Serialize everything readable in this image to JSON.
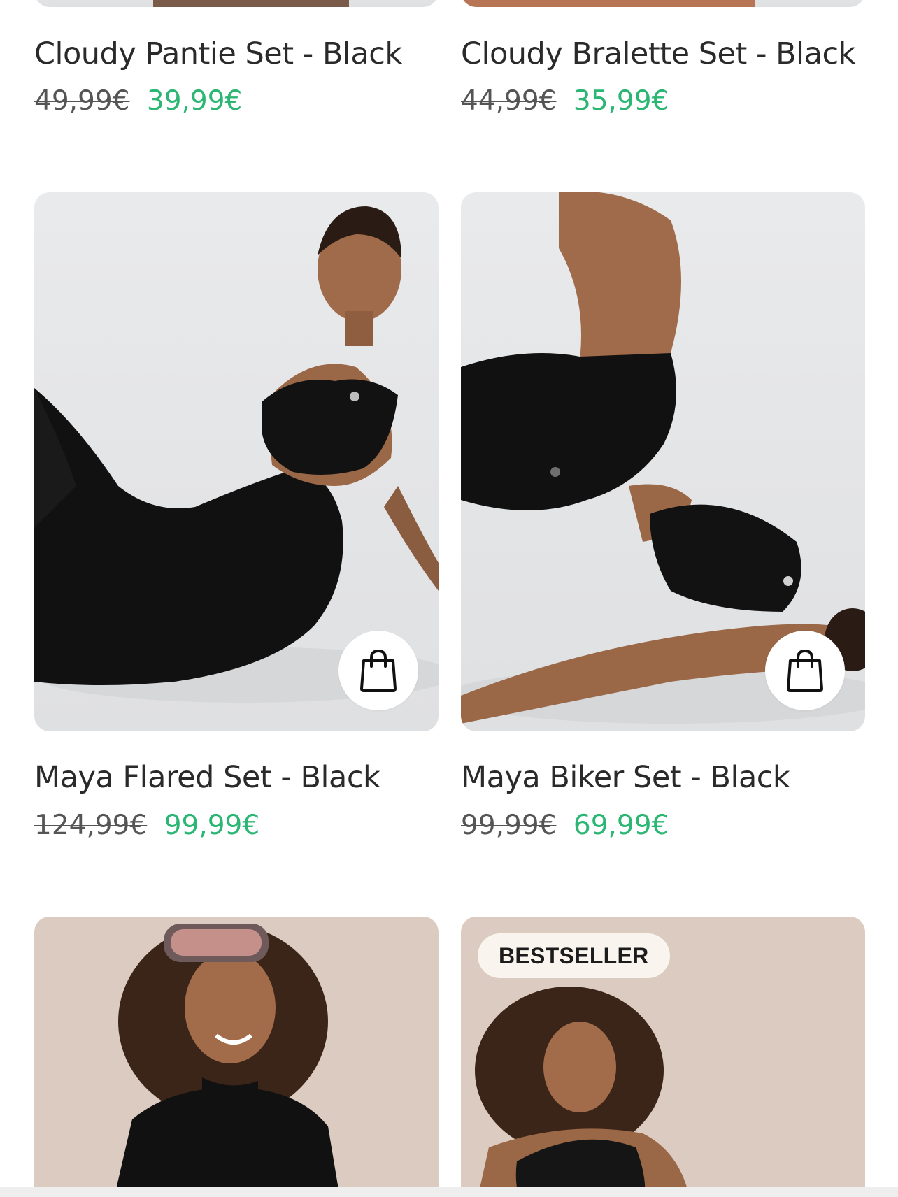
{
  "products": [
    {
      "title": "Cloudy Pantie Set - Black",
      "old_price": "49,99€",
      "new_price": "39,99€"
    },
    {
      "title": "Cloudy Bralette Set - Black",
      "old_price": "44,99€",
      "new_price": "35,99€"
    },
    {
      "title": "Maya Flared Set - Black",
      "old_price": "124,99€",
      "new_price": "99,99€"
    },
    {
      "title": "Maya Biker Set - Black",
      "old_price": "99,99€",
      "new_price": "69,99€"
    },
    {
      "title": "",
      "old_price": "",
      "new_price": ""
    },
    {
      "title": "",
      "old_price": "",
      "new_price": "",
      "badge": "BESTSELLER"
    }
  ],
  "icons": {
    "add_to_cart": "shopping-bag-icon"
  },
  "colors": {
    "sale_price": "#2bb673",
    "old_price": "#555555",
    "title": "#2a2a2a",
    "image_bg_grey": "#e6e7e9",
    "image_bg_beige": "#dccbc0",
    "badge_bg": "#faf4ee"
  }
}
